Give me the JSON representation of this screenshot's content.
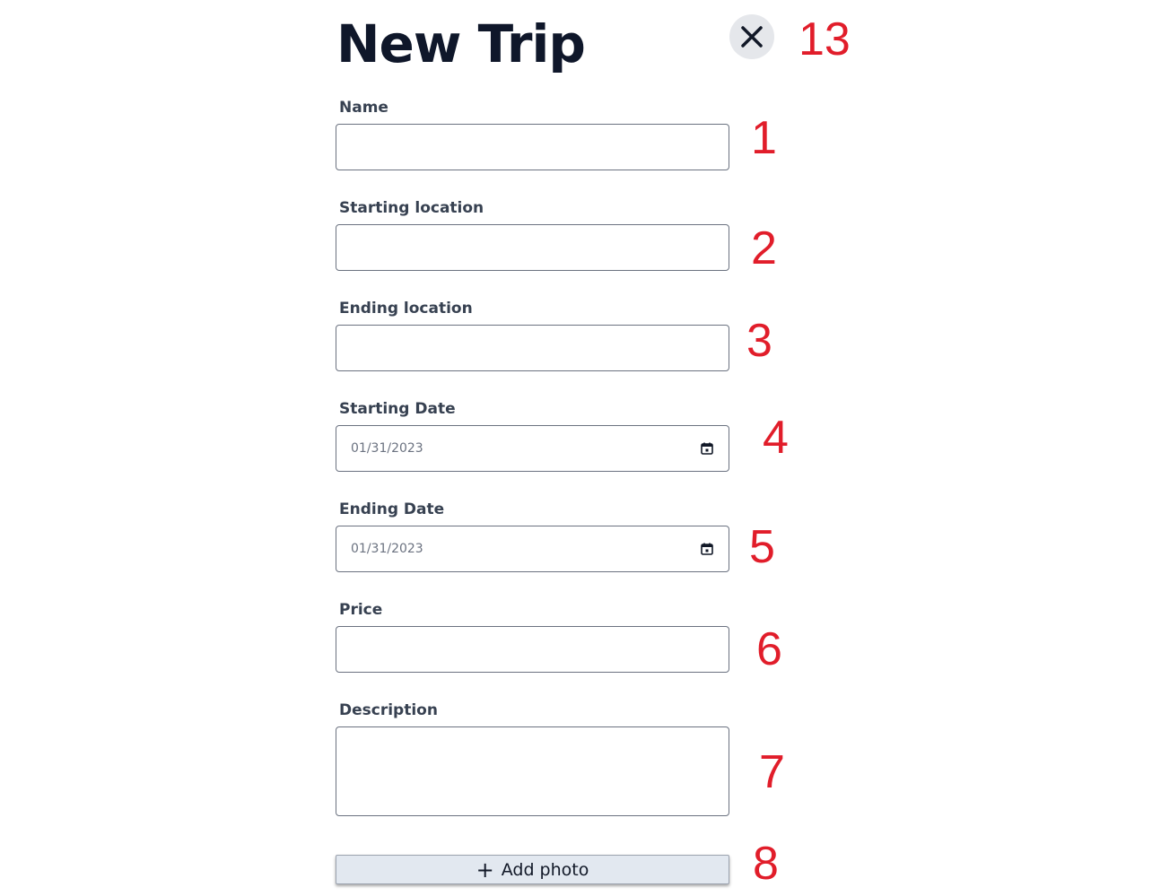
{
  "header": {
    "title": "New Trip",
    "close_icon": "close-icon"
  },
  "form": {
    "name": {
      "label": "Name",
      "value": ""
    },
    "starting_location": {
      "label": "Starting location",
      "value": ""
    },
    "ending_location": {
      "label": "Ending location",
      "value": ""
    },
    "starting_date": {
      "label": "Starting Date",
      "value": "01/31/2023",
      "icon": "calendar-icon"
    },
    "ending_date": {
      "label": "Ending Date",
      "value": "01/31/2023",
      "icon": "calendar-icon"
    },
    "price": {
      "label": "Price",
      "value": ""
    },
    "description": {
      "label": "Description",
      "value": ""
    },
    "add_photo": {
      "plus": "+",
      "label": "Add photo"
    }
  },
  "markers": [
    "1",
    "2",
    "3",
    "4",
    "5",
    "6",
    "7",
    "8",
    "13"
  ],
  "colors": {
    "marker": "#e11d2a",
    "add_photo_bg": "#e2e8f0",
    "close_bg": "#e5e7eb",
    "field_border": "#6b7280"
  }
}
